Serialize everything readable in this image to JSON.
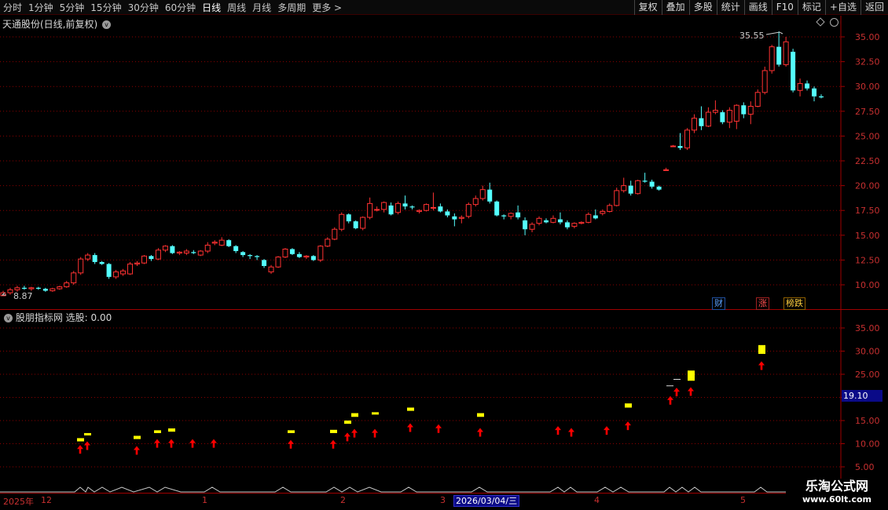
{
  "toolbar": {
    "periods": [
      "分时",
      "1分钟",
      "5分钟",
      "15分钟",
      "30分钟",
      "60分钟",
      "日线",
      "周线",
      "月线",
      "多周期",
      "更多 >"
    ],
    "active_period": "日线",
    "right_buttons": [
      "复权",
      "叠加",
      "多股",
      "统计",
      "画线",
      "F10",
      "标记",
      "+自选",
      "返回"
    ]
  },
  "main_panel": {
    "title": "天通股份(日线,前复权)",
    "high_label": "35.55",
    "low_label": "8.87",
    "y_ticks": [
      "35.00",
      "32.50",
      "30.00",
      "27.50",
      "25.00",
      "22.50",
      "20.00",
      "17.50",
      "15.00",
      "12.50",
      "10.00"
    ],
    "badges": [
      "财",
      "涨",
      "榜跌"
    ]
  },
  "sub_panel": {
    "title": "股朋指标网 选股: 0.00",
    "y_ticks": [
      "35.00",
      "30.00",
      "25.00",
      "20.00",
      "15.00",
      "10.00",
      "5.00"
    ],
    "selected_value": "19.10"
  },
  "date_axis": {
    "labels": [
      "2025年",
      "12",
      "1",
      "2",
      "3",
      "4",
      "5"
    ],
    "selected_date": "2026/03/04/三"
  },
  "watermark": {
    "line1": "乐淘公式网",
    "line2": "www.60lt.com"
  },
  "colors": {
    "up": "#ff3232",
    "down": "#54ffff",
    "grid": "#8b0000",
    "signal": "#ffff00",
    "arrow": "#ff0000"
  },
  "chart_data": {
    "type": "candlestick",
    "ylim": [
      8.5,
      36.5
    ],
    "ohlc": [
      [
        8.9,
        9.4,
        8.87,
        9.2
      ],
      [
        9.2,
        9.7,
        9.0,
        9.5
      ],
      [
        9.5,
        9.9,
        9.3,
        9.7
      ],
      [
        9.7,
        9.9,
        9.5,
        9.6
      ],
      [
        9.6,
        9.8,
        9.4,
        9.7
      ],
      [
        9.7,
        9.8,
        9.5,
        9.6
      ],
      [
        9.6,
        9.7,
        9.3,
        9.4
      ],
      [
        9.4,
        9.7,
        9.3,
        9.6
      ],
      [
        9.6,
        9.9,
        9.5,
        9.8
      ],
      [
        9.8,
        10.4,
        9.7,
        10.2
      ],
      [
        10.2,
        11.4,
        10.0,
        11.2
      ],
      [
        11.2,
        12.8,
        11.0,
        12.6
      ],
      [
        12.6,
        13.2,
        12.4,
        13.0
      ],
      [
        13.0,
        13.2,
        12.1,
        12.3
      ],
      [
        12.3,
        12.4,
        12.0,
        12.1
      ],
      [
        12.1,
        12.2,
        10.6,
        10.8
      ],
      [
        10.8,
        11.5,
        10.6,
        11.3
      ],
      [
        11.1,
        11.6,
        10.9,
        11.4
      ],
      [
        11.1,
        12.3,
        11.0,
        12.1
      ],
      [
        12.1,
        12.4,
        11.9,
        12.2
      ],
      [
        12.2,
        13.0,
        12.1,
        12.9
      ],
      [
        12.9,
        13.0,
        12.4,
        12.6
      ],
      [
        12.6,
        13.7,
        12.5,
        13.5
      ],
      [
        13.5,
        14.0,
        13.3,
        13.9
      ],
      [
        13.9,
        14.0,
        13.1,
        13.2
      ],
      [
        13.2,
        13.4,
        13.0,
        13.3
      ],
      [
        13.2,
        13.6,
        13.0,
        13.4
      ],
      [
        13.3,
        13.5,
        13.1,
        13.2
      ],
      [
        13.0,
        13.5,
        12.9,
        13.4
      ],
      [
        13.4,
        14.3,
        13.2,
        14.0
      ],
      [
        14.2,
        14.5,
        14.0,
        14.3
      ],
      [
        14.0,
        14.8,
        13.9,
        14.5
      ],
      [
        14.5,
        14.6,
        13.8,
        13.9
      ],
      [
        13.9,
        14.0,
        13.2,
        13.4
      ],
      [
        13.3,
        13.4,
        12.8,
        13.0
      ],
      [
        13.0,
        13.1,
        12.6,
        12.9
      ],
      [
        12.9,
        13.0,
        12.5,
        12.8
      ],
      [
        12.5,
        12.6,
        11.7,
        11.9
      ],
      [
        11.3,
        12.0,
        11.1,
        11.8
      ],
      [
        11.8,
        12.9,
        11.7,
        12.8
      ],
      [
        12.8,
        13.7,
        12.7,
        13.6
      ],
      [
        13.6,
        13.7,
        13.0,
        13.1
      ],
      [
        13.1,
        13.3,
        12.7,
        12.8
      ],
      [
        12.8,
        13.0,
        12.6,
        12.9
      ],
      [
        12.9,
        13.0,
        12.4,
        12.5
      ],
      [
        12.5,
        14.0,
        12.3,
        13.9
      ],
      [
        13.9,
        14.8,
        13.8,
        14.6
      ],
      [
        14.6,
        15.8,
        14.5,
        15.6
      ],
      [
        15.6,
        17.3,
        15.4,
        17.1
      ],
      [
        17.1,
        17.2,
        16.2,
        16.4
      ],
      [
        16.4,
        16.5,
        15.6,
        15.7
      ],
      [
        15.7,
        16.9,
        15.5,
        16.8
      ],
      [
        16.8,
        18.8,
        16.6,
        18.2
      ],
      [
        17.6,
        17.9,
        17.4,
        17.6
      ],
      [
        17.6,
        18.4,
        17.3,
        18.3
      ],
      [
        18.0,
        18.3,
        17.0,
        17.1
      ],
      [
        17.3,
        18.4,
        17.1,
        18.2
      ],
      [
        18.2,
        19.0,
        17.6,
        17.9
      ],
      [
        17.9,
        18.0,
        17.6,
        17.8
      ],
      [
        17.4,
        17.6,
        17.2,
        17.5
      ],
      [
        17.5,
        18.2,
        17.4,
        18.1
      ],
      [
        17.8,
        19.3,
        17.5,
        17.8
      ],
      [
        17.9,
        18.2,
        17.3,
        17.4
      ],
      [
        17.4,
        17.6,
        16.8,
        17.0
      ],
      [
        16.9,
        17.2,
        15.9,
        16.6
      ],
      [
        16.7,
        17.0,
        16.2,
        16.8
      ],
      [
        16.9,
        18.3,
        16.7,
        18.1
      ],
      [
        18.1,
        19.0,
        17.9,
        18.7
      ],
      [
        18.7,
        20.0,
        18.5,
        19.6
      ],
      [
        19.6,
        20.3,
        18.2,
        18.4
      ],
      [
        18.4,
        18.5,
        16.9,
        17.0
      ],
      [
        17.0,
        17.1,
        16.6,
        16.9
      ],
      [
        16.9,
        17.3,
        16.6,
        17.2
      ],
      [
        17.3,
        18.0,
        16.6,
        16.8
      ],
      [
        16.5,
        16.8,
        15.0,
        15.6
      ],
      [
        15.6,
        16.3,
        15.3,
        16.1
      ],
      [
        16.2,
        16.9,
        16.0,
        16.7
      ],
      [
        16.5,
        16.7,
        16.2,
        16.3
      ],
      [
        16.3,
        17.0,
        16.2,
        16.7
      ],
      [
        16.6,
        17.3,
        16.1,
        16.3
      ],
      [
        16.3,
        16.5,
        15.6,
        15.8
      ],
      [
        15.9,
        16.3,
        15.7,
        16.2
      ],
      [
        16.2,
        16.4,
        16.1,
        16.3
      ],
      [
        16.3,
        17.3,
        16.2,
        17.1
      ],
      [
        17.0,
        17.6,
        16.6,
        16.7
      ],
      [
        17.2,
        17.6,
        17.0,
        17.4
      ],
      [
        17.4,
        18.2,
        17.3,
        18.0
      ],
      [
        18.0,
        19.8,
        17.9,
        19.5
      ],
      [
        19.5,
        20.8,
        19.3,
        20.0
      ],
      [
        20.0,
        20.5,
        19.0,
        19.2
      ],
      [
        19.2,
        20.6,
        19.1,
        20.5
      ],
      [
        20.5,
        21.3,
        20.3,
        20.4
      ],
      [
        20.4,
        20.6,
        19.7,
        19.9
      ],
      [
        19.9,
        20.0,
        19.5,
        19.6
      ],
      [
        21.6,
        21.8,
        21.5,
        21.6
      ],
      [
        24.0,
        24.1,
        23.9,
        24.0
      ],
      [
        24.0,
        25.3,
        23.6,
        23.8
      ],
      [
        23.8,
        25.8,
        23.6,
        25.6
      ],
      [
        25.6,
        27.2,
        25.3,
        26.8
      ],
      [
        26.8,
        28.0,
        25.6,
        26.0
      ],
      [
        26.0,
        27.9,
        25.9,
        27.4
      ],
      [
        27.4,
        28.6,
        27.2,
        27.6
      ],
      [
        27.4,
        27.6,
        26.2,
        26.4
      ],
      [
        26.4,
        27.9,
        25.8,
        27.6
      ],
      [
        26.5,
        28.2,
        25.7,
        28.1
      ],
      [
        28.1,
        28.4,
        26.8,
        27.2
      ],
      [
        27.2,
        28.5,
        26.2,
        28.0
      ],
      [
        28.0,
        29.7,
        27.9,
        29.4
      ],
      [
        29.4,
        32.0,
        29.2,
        31.6
      ],
      [
        31.6,
        34.2,
        31.3,
        34.0
      ],
      [
        34.0,
        35.55,
        32.0,
        32.2
      ],
      [
        32.2,
        35.0,
        32.0,
        34.5
      ],
      [
        33.5,
        33.8,
        29.4,
        29.6
      ],
      [
        29.6,
        30.8,
        29.0,
        30.3
      ],
      [
        30.3,
        30.6,
        29.6,
        29.8
      ],
      [
        29.8,
        30.0,
        28.5,
        29.0
      ],
      [
        29.0,
        29.2,
        28.8,
        28.9
      ]
    ],
    "signal_bars": [
      [
        10.5,
        11.2
      ],
      [
        11.8,
        12.3
      ],
      [
        11.0,
        11.7
      ],
      [
        12.3,
        12.9
      ],
      [
        12.6,
        13.3
      ],
      [
        12.3,
        12.9
      ],
      [
        12.3,
        13.0
      ],
      [
        14.3,
        15.0
      ],
      [
        15.8,
        16.6
      ],
      [
        16.4,
        16.8
      ],
      [
        17.1,
        17.8
      ],
      [
        15.8,
        16.6
      ],
      [
        17.8,
        18.7
      ],
      [
        23.6,
        25.8
      ],
      [
        29.4,
        31.3
      ]
    ],
    "signal_lines": [
      22.5,
      23.9
    ]
  }
}
